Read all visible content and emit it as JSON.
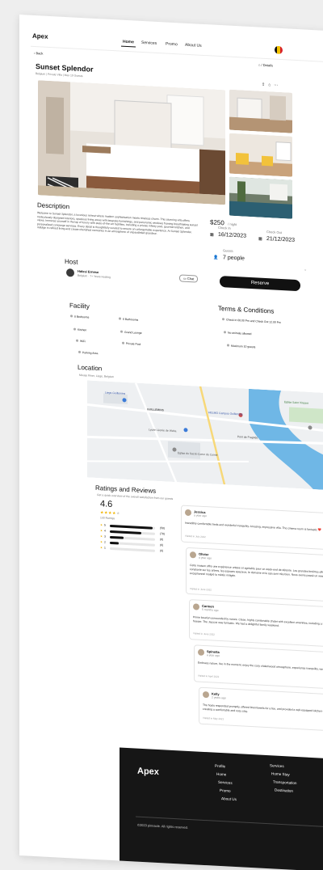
{
  "brand": "Apex",
  "nav": [
    "Home",
    "Services",
    "Promo",
    "About Us"
  ],
  "back_label": "Back",
  "breadcrumb": "Details",
  "property": {
    "title": "Sunset Splendor",
    "meta": "Belgium | Private Villa | Max 10 Guests",
    "description_heading": "Description",
    "description": "Welcome to Sunset Splendor, a luxurious retreat where modern sophistication meets timeless charm. This stunning villa offers meticulously designed interiors, spacious living areas with bespoke furnishings, and panoramic windows framing breathtaking sunset views. Immerse yourself in the lap of luxury with state-of-the-art facilities, including a private infinity pool, gourmet kitchen, and personalized concierge services. Every detail is thoughtfully curated to ensure an unforgettable experience. At Sunset Splendor, indulge in refined living and create cherished memories in an atmosphere of unparalleled grandeur."
  },
  "booking": {
    "price": "$250",
    "per": "/ night",
    "checkin_label": "Check In",
    "checkin": "16/12/2023",
    "checkout_label": "Check Out",
    "checkout": "21/12/2023",
    "guests_label": "Guests",
    "guests": "7 people",
    "reserve": "Reserve"
  },
  "host": {
    "heading": "Host",
    "name": "Halesi Ernese",
    "location": "Belgium",
    "years": "7+ Years Hosting",
    "chat": "Chat"
  },
  "facility": {
    "heading": "Facility",
    "items": [
      "8 Bedrooms",
      "6 Bathrooms",
      "Kitchen",
      "Grand Lounge",
      "WiFi",
      "Private Pool",
      "Parking Area"
    ]
  },
  "terms": {
    "heading": "Terms & Conditions",
    "items": [
      "Check In 08.00 Pm and Check Out 12.00 Pm",
      "No animals allowed",
      "Maximum 10 guests"
    ]
  },
  "location": {
    "heading": "Location",
    "address": "Meuse River, Liege, Belgium",
    "map_labels": [
      "Liege-Guillemins",
      "GUILLEMINS",
      "Pont de Fragnée",
      "Eglise du Sacré-Coeur de Cointe",
      "HELMO Campus Guillemins",
      "Eglise Saint Vincent",
      "Lycée Léonie de Waha"
    ]
  },
  "reviews": {
    "heading": "Ratings and Reviews",
    "subheading": "Get a quick overview of the overall satisfaction from our guests",
    "score": "4.6",
    "count": "130 Ratings",
    "stars": 4.5,
    "breakdown": [
      {
        "label": "5",
        "count": "(58)",
        "fraction": 0.95
      },
      {
        "label": "4",
        "count": "(78)",
        "fraction": 0.7
      },
      {
        "label": "3",
        "count": "(8)",
        "fraction": 0.3
      },
      {
        "label": "2",
        "count": "(6)",
        "fraction": 0.2
      },
      {
        "label": "1",
        "count": "(0)",
        "fraction": 0.0
      }
    ],
    "items": [
      {
        "name": "Jessica",
        "ago": "a year ago",
        "text": "Incredibly comfortable beds and wonderful tranquility. Amazing, impressive villa. The cinema room is fantastic ❤️",
        "visited": "Visited in July 2022"
      },
      {
        "name": "Olivier",
        "ago": "a year ago",
        "text": "Cette maison offre une expérience unique et agréable pour un week-end de détente. Les grandes fenêtres offrent une vue constante sur les arbres, les espaces spacieux, le domaine et le spa sont très bien. Nous avons passé un week-end exceptionnel malgré la météo mitigée.",
        "visited": "Visited in June 2022"
      },
      {
        "name": "Carmen",
        "ago": "5 months ago",
        "text": "Prime location surrounded by nature. Clean, highly comfortable chalet with excellent amenities, including a fridge and a full freezer. The Jacuzzi was fantastic. We had a delightful family weekend.",
        "visited": "Visited in June 2022"
      },
      {
        "name": "Spinetta",
        "ago": "a year ago",
        "text": "Embrace nature, live in the moment, enjoy the cozy chalet/wood atmosphere, experience tranquility, well equipped 😊",
        "visited": "Visited in April 2022"
      },
      {
        "name": "Kelly",
        "ago": "2 years ago",
        "text": "The hosts responded promptly, offered linen/towels for a fee, and provided a well-equipped kitchen with ample workspace, creating a comfortable and cozy stay.",
        "visited": "Visited in May 2021"
      }
    ]
  },
  "footer": {
    "brand": "Apex",
    "col1": [
      "Profile",
      "Home",
      "Services",
      "Promo",
      "About Us"
    ],
    "col2": [
      "Services",
      "Home Stay",
      "Transportation",
      "Destination"
    ],
    "copyright": "©2023 pinnacle. All rights reserved."
  }
}
